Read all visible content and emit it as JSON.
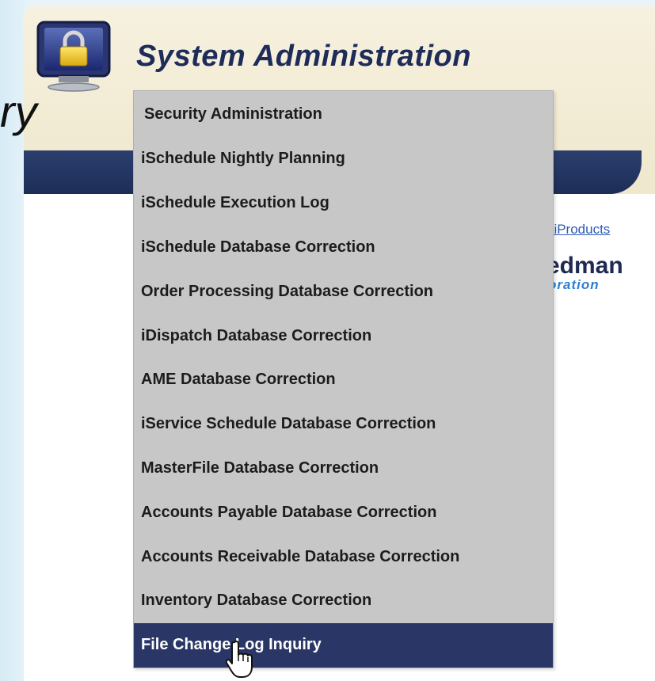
{
  "header": {
    "title": "System Administration",
    "icon": "lock-monitor-icon",
    "behind_text": "ry"
  },
  "page": {
    "link_text": "t iProducts",
    "logo_text": "edman",
    "logo_subtext": "oration"
  },
  "menu": {
    "items": [
      {
        "label": "Security Administration"
      },
      {
        "label": "iSchedule Nightly Planning"
      },
      {
        "label": "iSchedule Execution Log"
      },
      {
        "label": "iSchedule Database Correction"
      },
      {
        "label": "Order Processing Database Correction"
      },
      {
        "label": "iDispatch Database Correction"
      },
      {
        "label": "AME Database Correction"
      },
      {
        "label": "iService Schedule Database Correction"
      },
      {
        "label": "MasterFile Database Correction"
      },
      {
        "label": "Accounts Payable Database Correction"
      },
      {
        "label": "Accounts Receivable Database Correction"
      },
      {
        "label": "Inventory Database Correction"
      },
      {
        "label": "File Change Log Inquiry",
        "selected": true
      }
    ]
  },
  "colors": {
    "menu_bg": "#c7c7c7",
    "menu_selected_bg": "#2a3766",
    "header_band": "#1d2d56",
    "title_color": "#1e2c5a",
    "link_color": "#2a5bb8"
  },
  "cursor_icon": "hand-pointer-icon"
}
